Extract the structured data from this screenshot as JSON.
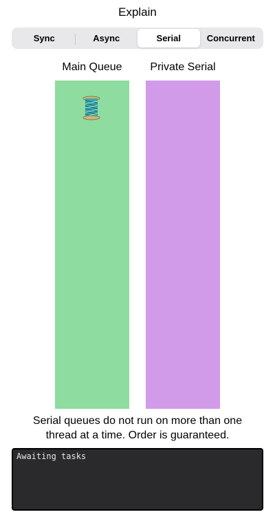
{
  "title": "Explain",
  "segments": [
    {
      "label": "Sync",
      "selected": false
    },
    {
      "label": "Async",
      "selected": false
    },
    {
      "label": "Serial",
      "selected": true
    },
    {
      "label": "Concurrent",
      "selected": false
    }
  ],
  "queues": {
    "main": {
      "label": "Main Queue",
      "color": "#8edc9f"
    },
    "private": {
      "label": "Private Serial",
      "color": "#d29be9"
    }
  },
  "task_icon": "thread-spool-icon",
  "description_line1": "Serial queues do not run on more than one",
  "description_line2": "thread at a time. Order is guaranteed.",
  "console": {
    "text": "Awaiting tasks"
  }
}
